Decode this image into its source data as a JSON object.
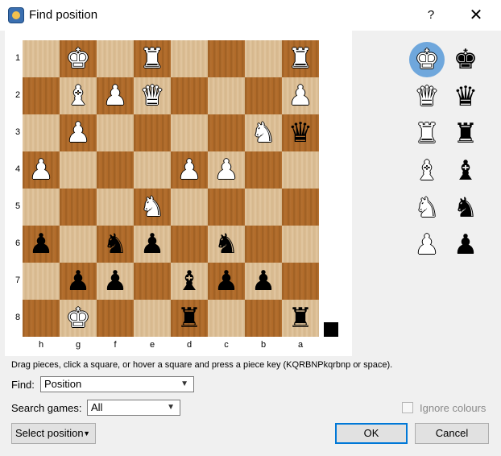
{
  "window": {
    "title": "Find position",
    "help_label": "?",
    "close_label": "✕"
  },
  "board": {
    "rank_labels": [
      "1",
      "2",
      "3",
      "4",
      "5",
      "6",
      "7",
      "8"
    ],
    "file_labels": [
      "h",
      "g",
      "f",
      "e",
      "d",
      "c",
      "b",
      "a"
    ],
    "rows": [
      [
        "",
        "K",
        "",
        "R",
        "",
        "",
        "",
        "R"
      ],
      [
        "",
        "B",
        "P",
        "Q",
        "",
        "",
        "",
        "P"
      ],
      [
        "",
        "P",
        "",
        "",
        "",
        "",
        "N",
        "q"
      ],
      [
        "P",
        "",
        "",
        "",
        "P",
        "P",
        "",
        ""
      ],
      [
        "",
        "",
        "",
        "N",
        "",
        "",
        "",
        ""
      ],
      [
        "p",
        "",
        "n",
        "p",
        "",
        "n",
        "",
        ""
      ],
      [
        "",
        "p",
        "p",
        "",
        "b",
        "p",
        "p",
        ""
      ],
      [
        "",
        "K",
        "",
        "",
        "r",
        "",
        "",
        "r"
      ]
    ],
    "first_square_light": true,
    "side_to_move": "black"
  },
  "palette": {
    "rows": [
      [
        "K",
        "k"
      ],
      [
        "Q",
        "q"
      ],
      [
        "R",
        "r"
      ],
      [
        "B",
        "b"
      ],
      [
        "N",
        "n"
      ],
      [
        "P",
        "p"
      ]
    ],
    "selected": "K"
  },
  "hint": "Drag pieces, click a square, or hover a square and press a piece key (KQRBNPkqrbnp or space).",
  "find": {
    "label": "Find:",
    "value": "Position"
  },
  "search_games": {
    "label": "Search games:",
    "value": "All"
  },
  "ignore_colours": {
    "label": "Ignore colours",
    "checked": false,
    "enabled": false
  },
  "buttons": {
    "select_position": "Select position",
    "ok": "OK",
    "cancel": "Cancel"
  },
  "colors": {
    "light_square": "#dcbd92",
    "dark_square": "#b06a28",
    "palette_selection": "#6fa7dc",
    "default_button_border": "#0078d7"
  }
}
